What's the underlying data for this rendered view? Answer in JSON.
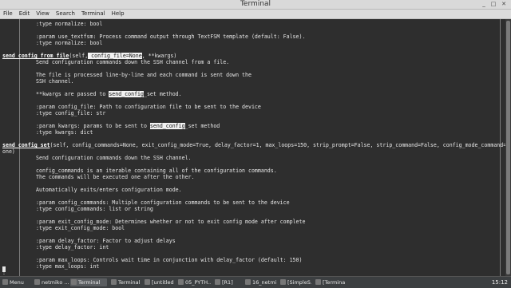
{
  "window": {
    "title": "Terminal"
  },
  "window_controls": {
    "minimize": "_",
    "maximize": "□",
    "close": "✕"
  },
  "menu": [
    "File",
    "Edit",
    "View",
    "Search",
    "Terminal",
    "Help"
  ],
  "terminal": {
    "lines": [
      ":type normalize: bool",
      "",
      ":param use_textfsm: Process command output through TextFSM template (default: False).",
      ":type normalize: bool",
      "",
      "send_config_from_file(self, config_file=None, **kwargs)",
      "Send configuration commands down the SSH channel from a file.",
      "",
      "The file is processed line-by-line and each command is sent down the",
      "SSH channel.",
      "",
      "**kwargs are passed to send_config_set method.",
      "",
      ":param config_file: Path to configuration file to be sent to the device",
      ":type config_file: str",
      "",
      ":param kwargs: params to be sent to send_config_set method",
      ":type kwargs: dict",
      "",
      "send_config_set(self, config_commands=None, exit_config_mode=True, delay_factor=1, max_loops=150, strip_prompt=False, strip_command=False, config_mode_command=N",
      "one)",
      "Send configuration commands down the SSH channel.",
      "",
      "config_commands is an iterable containing all of the configuration commands.",
      "The commands will be executed one after the other.",
      "",
      "Automatically exits/enters configuration mode.",
      "",
      ":param config_commands: Multiple configuration commands to be sent to the device",
      ":type config_commands: list or string",
      "",
      ":param exit_config_mode: Determines whether or not to exit config mode after complete",
      ":type exit_config_mode: bool",
      "",
      ":param delay_factor: Factor to adjust delays",
      ":type delay_factor: int",
      "",
      ":param max_loops: Controls wait time in conjunction with delay_factor (default: 150)",
      ":type max_loops: int",
      ":"
    ]
  },
  "taskbar": {
    "menu_label": "Menu",
    "items": [
      "netmiko ...",
      "Terminal",
      "Terminal",
      "[untitled ...",
      "05_PYTH...",
      "[R1]",
      "16_netmi...",
      "[SimpleS...",
      "[Terminal]"
    ],
    "clock": "15:12"
  }
}
